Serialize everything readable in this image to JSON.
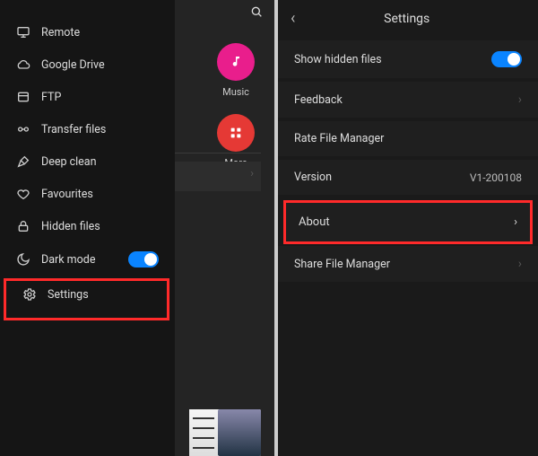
{
  "sidebar": {
    "items": [
      {
        "label": "Remote"
      },
      {
        "label": "Google Drive"
      },
      {
        "label": "FTP"
      },
      {
        "label": "Transfer files"
      },
      {
        "label": "Deep clean"
      },
      {
        "label": "Favourites"
      },
      {
        "label": "Hidden files"
      },
      {
        "label": "Dark mode"
      },
      {
        "label": "Settings"
      }
    ]
  },
  "launcher": {
    "items": [
      {
        "label": "Music"
      },
      {
        "label": "More"
      }
    ]
  },
  "settings": {
    "title": "Settings",
    "show_hidden": "Show hidden files",
    "feedback": "Feedback",
    "rate": "Rate File Manager",
    "version_label": "Version",
    "version_value": "V1-200108",
    "about": "About",
    "share": "Share File Manager"
  }
}
